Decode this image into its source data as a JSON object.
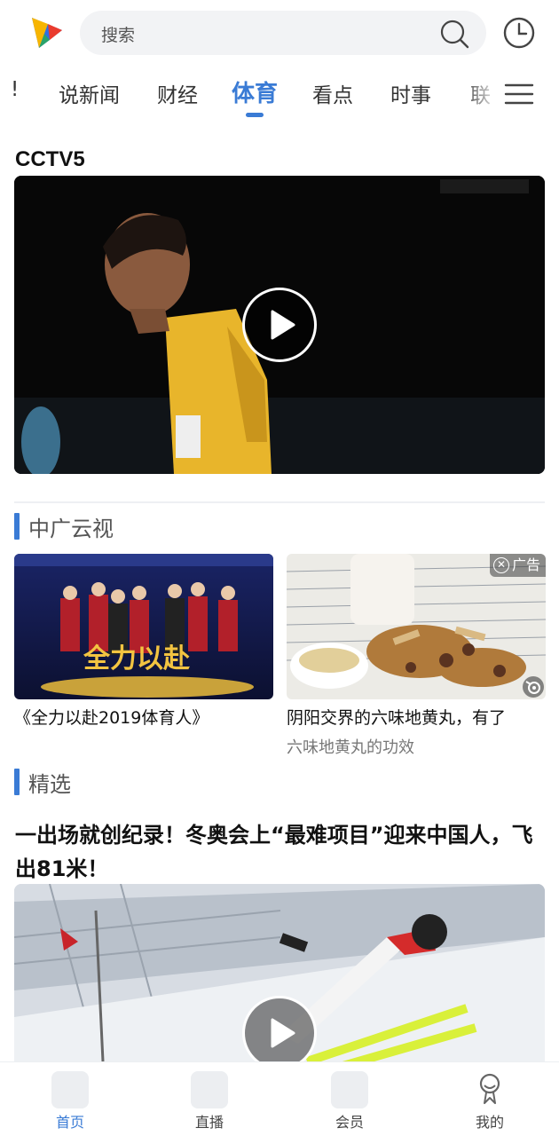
{
  "header": {
    "search_placeholder": "搜索"
  },
  "tabs": {
    "items": [
      {
        "label": "!"
      },
      {
        "label": "说新闻"
      },
      {
        "label": "财经"
      },
      {
        "label": "体育",
        "active": true
      },
      {
        "label": "看点"
      },
      {
        "label": "时事"
      },
      {
        "label": "联"
      }
    ]
  },
  "cctv": {
    "title": "CCTV5"
  },
  "zgys": {
    "section_title": "中广云视",
    "cards": [
      {
        "title": "《全力以赴2019体育人》"
      },
      {
        "title": "阴阳交界的六味地黄丸，有了",
        "subtitle": "六味地黄丸的功效",
        "ad_label": "广告"
      }
    ]
  },
  "featured": {
    "section_title": "精选",
    "article_title": "一出场就创纪录！冬奥会上“最难项目”迎来中国人，飞出81米！"
  },
  "bottom_nav": {
    "items": [
      {
        "label": "首页",
        "active": true
      },
      {
        "label": "直播"
      },
      {
        "label": "会员"
      },
      {
        "label": "我的"
      }
    ]
  },
  "colors": {
    "accent": "#3a7bd5"
  }
}
